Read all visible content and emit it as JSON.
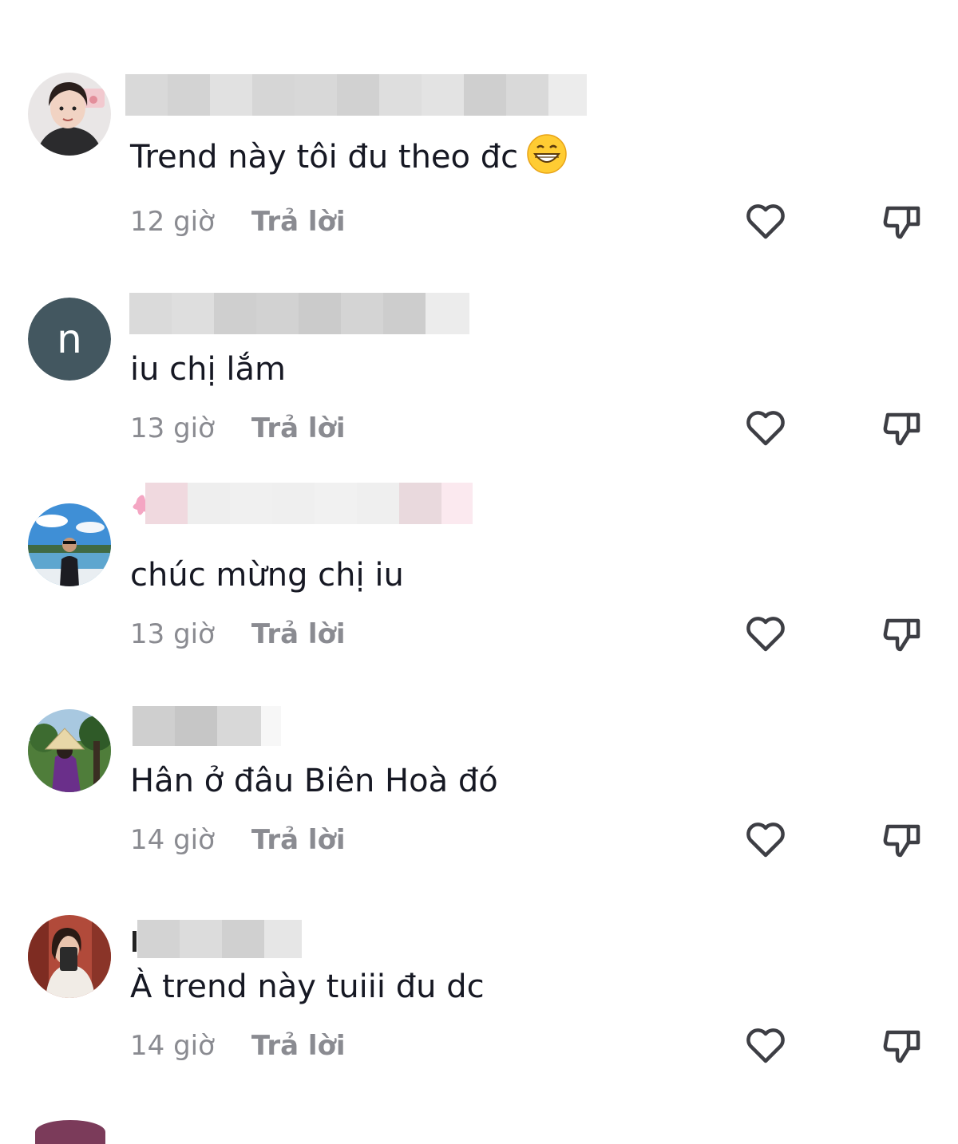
{
  "colors": {
    "text": "#161823",
    "meta": "#8a8b91",
    "icon": "#3d3e44",
    "blur_gray": "#d7d7d7",
    "blur_pink": "#efd6dd"
  },
  "comments": [
    {
      "text": "Trend này tôi đu theo đc",
      "emoji": "grinning-face-emoji",
      "time": "12 giờ",
      "reply": "Trả lời",
      "avatar": "photo-avatar-girl"
    },
    {
      "text": "iu chị lắm",
      "time": "13 giờ",
      "reply": "Trả lời",
      "avatar_letter": "n",
      "avatar_color": "#435760"
    },
    {
      "text": "chúc mừng chị iu",
      "time": "13 giờ",
      "reply": "Trả lời",
      "avatar": "photo-avatar-man-lake"
    },
    {
      "text": "Hân ở đâu Biên Hoà đó",
      "time": "14 giờ",
      "reply": "Trả lời",
      "avatar": "photo-avatar-woman-hat"
    },
    {
      "text": "À trend này tuiii đu dc",
      "time": "14 giờ",
      "reply": "Trả lời",
      "avatar": "photo-avatar-mirror-selfie"
    }
  ]
}
